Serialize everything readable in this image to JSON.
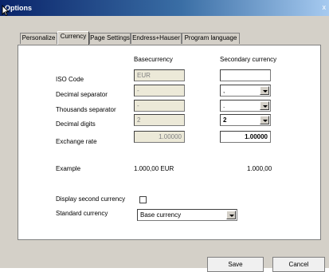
{
  "window": {
    "title": "Options",
    "close_glyph": "x"
  },
  "tabs": [
    {
      "label": "Personalize"
    },
    {
      "label": "Currency"
    },
    {
      "label": "Page Settings"
    },
    {
      "label": "Endress+Hauser"
    },
    {
      "label": "Program language"
    }
  ],
  "currency": {
    "col_base": "Basecurrency",
    "col_secondary": "Secondary currency",
    "rows": {
      "iso_code": {
        "label": "ISO Code",
        "base": "EUR",
        "secondary": ""
      },
      "decimal_separator": {
        "label": "Decimal separator",
        "base": "-",
        "secondary": ","
      },
      "thousands_separator": {
        "label": "Thousands separator",
        "base": "-",
        "secondary": "."
      },
      "decimal_digits": {
        "label": "Decimal digits",
        "base": "2",
        "secondary": "2"
      },
      "exchange_rate": {
        "label": "Exchange rate",
        "base": "1.00000",
        "secondary": "1.00000"
      }
    },
    "example": {
      "label": "Example",
      "base": "1.000,00 EUR",
      "secondary": "1.000,00"
    },
    "display_second": {
      "label": "Display second currency",
      "checked": false
    },
    "standard": {
      "label": "Standard currency",
      "value": "Base currency"
    }
  },
  "buttons": {
    "save": "Save",
    "cancel": "Cancel"
  },
  "colors": {
    "titlebar": "#0a246a",
    "dialog_bg": "#d4d0c8",
    "panel_bg": "#ffffff"
  }
}
